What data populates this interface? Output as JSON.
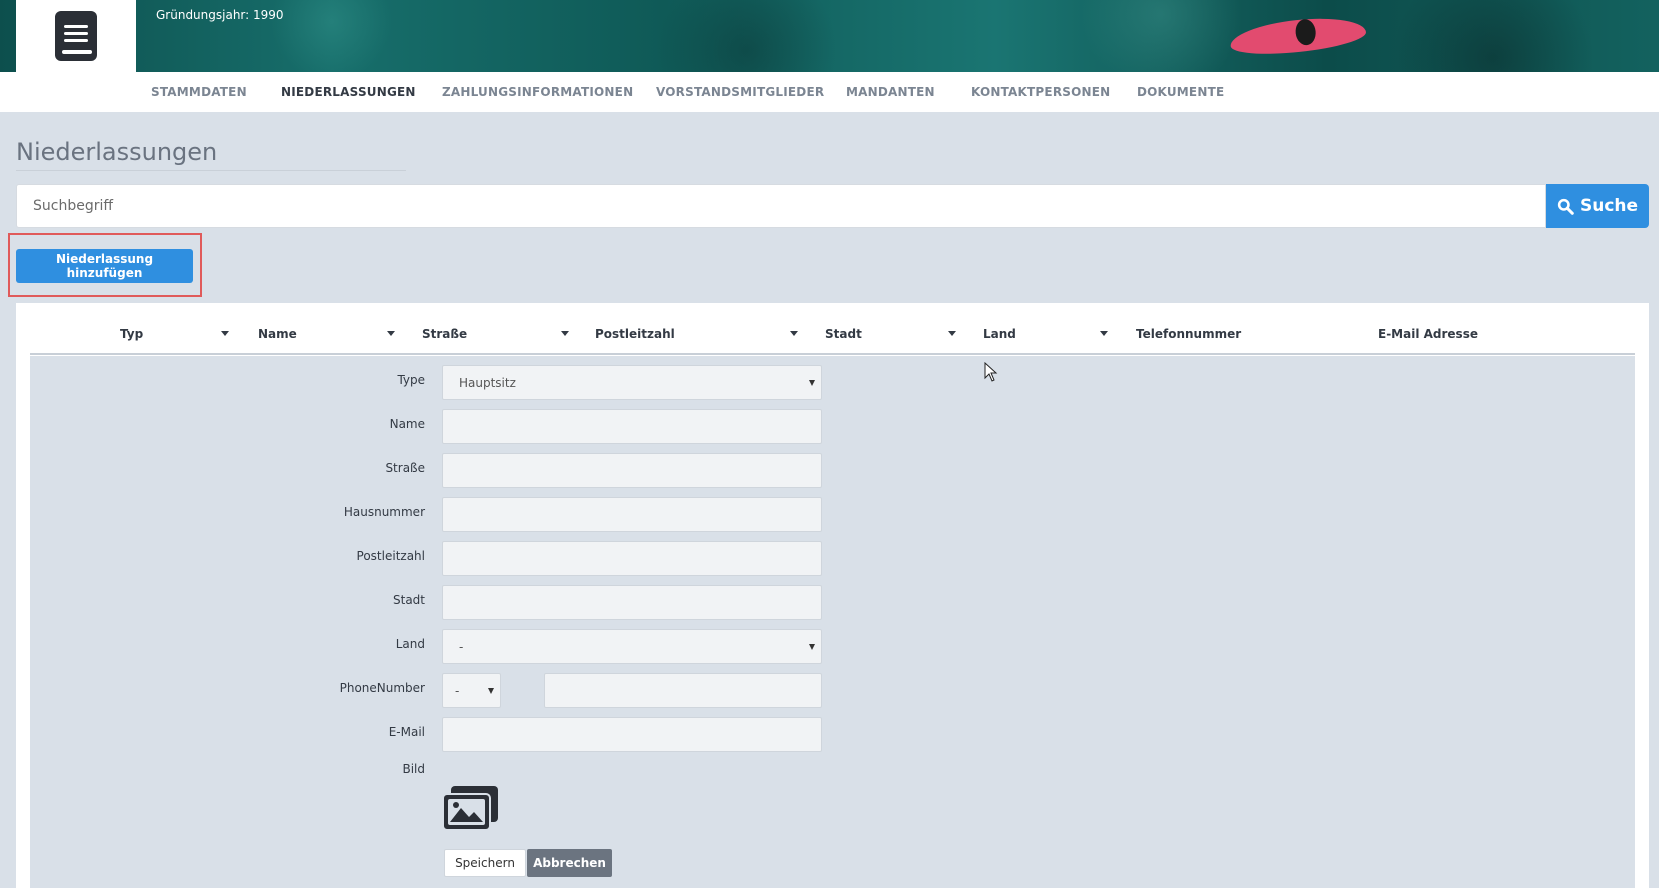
{
  "header": {
    "founding_year": "Gründungsjahr: 1990"
  },
  "tabs": [
    {
      "label": "STAMMDATEN",
      "active": false
    },
    {
      "label": "NIEDERLASSUNGEN",
      "active": true
    },
    {
      "label": "ZAHLUNGSINFORMATIONEN",
      "active": false
    },
    {
      "label": "VORSTANDSMITGLIEDER",
      "active": false
    },
    {
      "label": "MANDANTEN",
      "active": false
    },
    {
      "label": "KONTAKTPERSONEN",
      "active": false
    },
    {
      "label": "DOKUMENTE",
      "active": false
    }
  ],
  "page": {
    "title": "Niederlassungen"
  },
  "search": {
    "placeholder": "Suchbegriff",
    "button_label": "Suche"
  },
  "add_button_label": "Niederlassung hinzufügen",
  "table": {
    "columns": [
      "Typ",
      "Name",
      "Straße",
      "Postleitzahl",
      "Stadt",
      "Land",
      "Telefonnummer",
      "E-Mail Adresse"
    ]
  },
  "form": {
    "labels": {
      "type": "Type",
      "name": "Name",
      "street": "Straße",
      "house_number": "Hausnummer",
      "postal_code": "Postleitzahl",
      "city": "Stadt",
      "country": "Land",
      "phone": "PhoneNumber",
      "email": "E-Mail",
      "image": "Bild"
    },
    "values": {
      "type": "Hauptsitz",
      "country": "-",
      "phone_prefix": "-"
    },
    "save_label": "Speichern",
    "cancel_label": "Abbrechen"
  },
  "colors": {
    "accent": "#2f8fe0",
    "highlight": "#e05a5a",
    "background": "#d9e0e8"
  }
}
